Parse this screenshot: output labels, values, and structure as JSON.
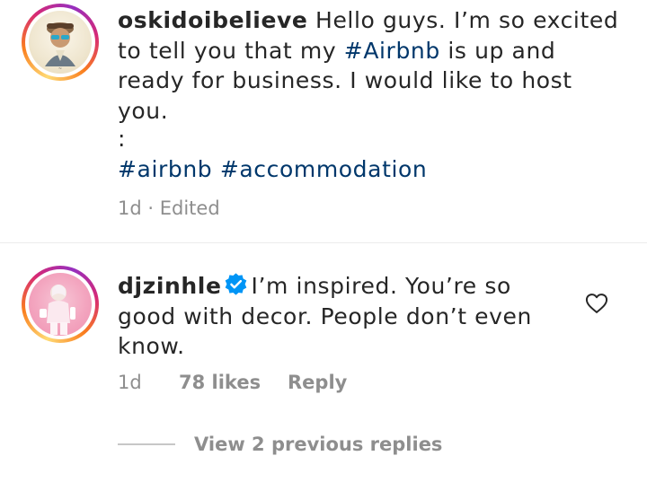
{
  "caption": {
    "username": "oskidoibelieve",
    "text_line1": " Hello guys. I’m so excited",
    "text_line2a": "to tell you that my ",
    "hashtag_inline": "#Airbnb",
    "text_line2b": " is up and",
    "text_line3": "ready for business. I would like to host",
    "text_line4": "you.",
    "separator": ":",
    "hashtag1": "#airbnb",
    "hashtag2": "#accommodation",
    "time": "1d",
    "dot": " · ",
    "edited": "Edited"
  },
  "comment": {
    "username": "djzinhle",
    "text_line1": "I’m inspired. You’re so",
    "text_line2": "good with decor. People don’t even",
    "text_line3": "know.",
    "time": "1d",
    "likes": "78 likes",
    "reply": "Reply",
    "view_replies": "View 2 previous replies"
  },
  "icons": {
    "verified": "verified-badge-icon",
    "like": "heart-outline-icon"
  },
  "colors": {
    "hashtag": "#00376b",
    "verified": "#0095f6",
    "meta": "#8e8e8e"
  }
}
